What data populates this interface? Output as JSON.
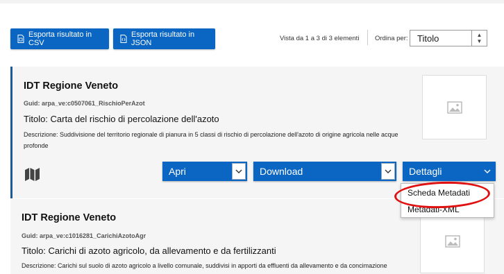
{
  "toolbar": {
    "export_csv_label": "Esporta risultato in CSV",
    "export_json_label": "Esporta risultato in JSON",
    "results_count": "Vista da 1 a 3 di 3 elementi",
    "sort_label": "Ordina per:",
    "sort_value": "Titolo"
  },
  "results": [
    {
      "organization": "IDT Regione Veneto",
      "guid": "Guid: arpa_ve:c0507061_RischioPerAzot",
      "title": "Titolo: Carta del rischio di percolazione dell'azoto",
      "description": "Descrizione: Suddivisione del territorio regionale di pianura in 5 classi di rischio di percolazione dell'azoto di origine agricola nelle acque profonde",
      "actions": {
        "open": "Apri",
        "download": "Download",
        "details": "Dettagli"
      }
    },
    {
      "organization": "IDT Regione Veneto",
      "guid": "Guid: arpa_ve:c1016281_CarichiAzotoAgr",
      "title": "Titolo: Carichi di azoto agricolo, da allevamento e da fertilizzanti",
      "description": "Descrizione: Carichi sul suolo di azoto agricolo a livello comunale, suddivisi in apporti da effluenti da allevamento e da concimazione"
    }
  ],
  "details_menu": {
    "items": [
      "Scheda Metadati",
      "Metadati-XML"
    ]
  },
  "colors": {
    "primary": "#0a66c2",
    "card_accent": "#1b5b9c",
    "annotation": "#e01010"
  }
}
